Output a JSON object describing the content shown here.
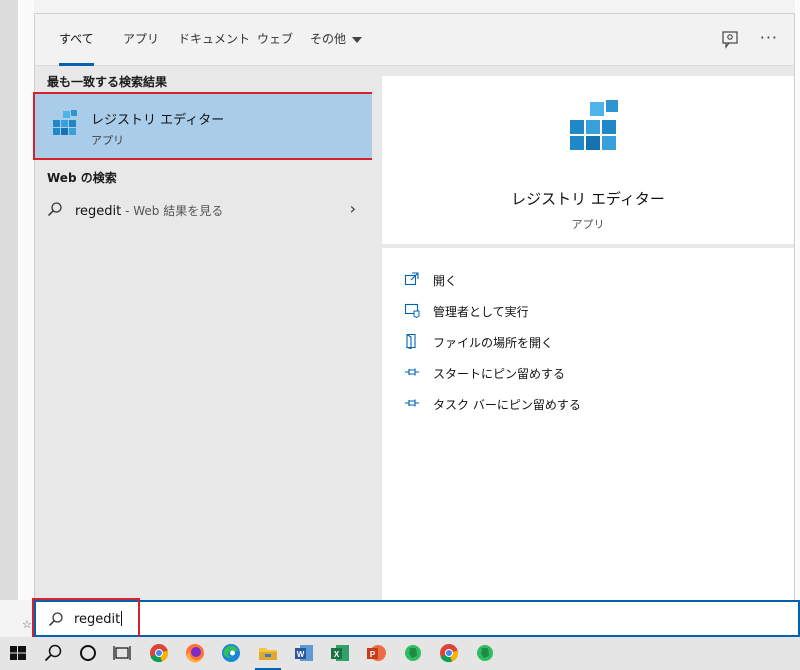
{
  "tabs": [
    {
      "label": "すべて",
      "active": true
    },
    {
      "label": "アプリ"
    },
    {
      "label": "ドキュメント"
    },
    {
      "label": "ウェブ"
    },
    {
      "label": "その他"
    }
  ],
  "toolbar": {
    "more": "···"
  },
  "left": {
    "best_match_heading": "最も一致する検索結果",
    "best_match": {
      "title": "レジストリ エディター",
      "subtitle": "アプリ"
    },
    "web_heading": "Web の検索",
    "web_result": {
      "query": "regedit",
      "hint": " - Web 結果を見る",
      "chevron": "›"
    }
  },
  "detail": {
    "title": "レジストリ エディター",
    "subtitle": "アプリ",
    "actions": [
      {
        "label": "開く",
        "icon": "open-icon"
      },
      {
        "label": "管理者として実行",
        "icon": "run-as-admin-icon"
      },
      {
        "label": "ファイルの場所を開く",
        "icon": "file-location-icon"
      },
      {
        "label": "スタートにピン留めする",
        "icon": "pin-icon"
      },
      {
        "label": "タスク バーにピン留めする",
        "icon": "pin-icon"
      }
    ]
  },
  "searchbox": {
    "value": "regedit"
  },
  "colors": {
    "accent": "#0063b1",
    "highlight": "#a9cde9",
    "outline": "#d6222a"
  }
}
